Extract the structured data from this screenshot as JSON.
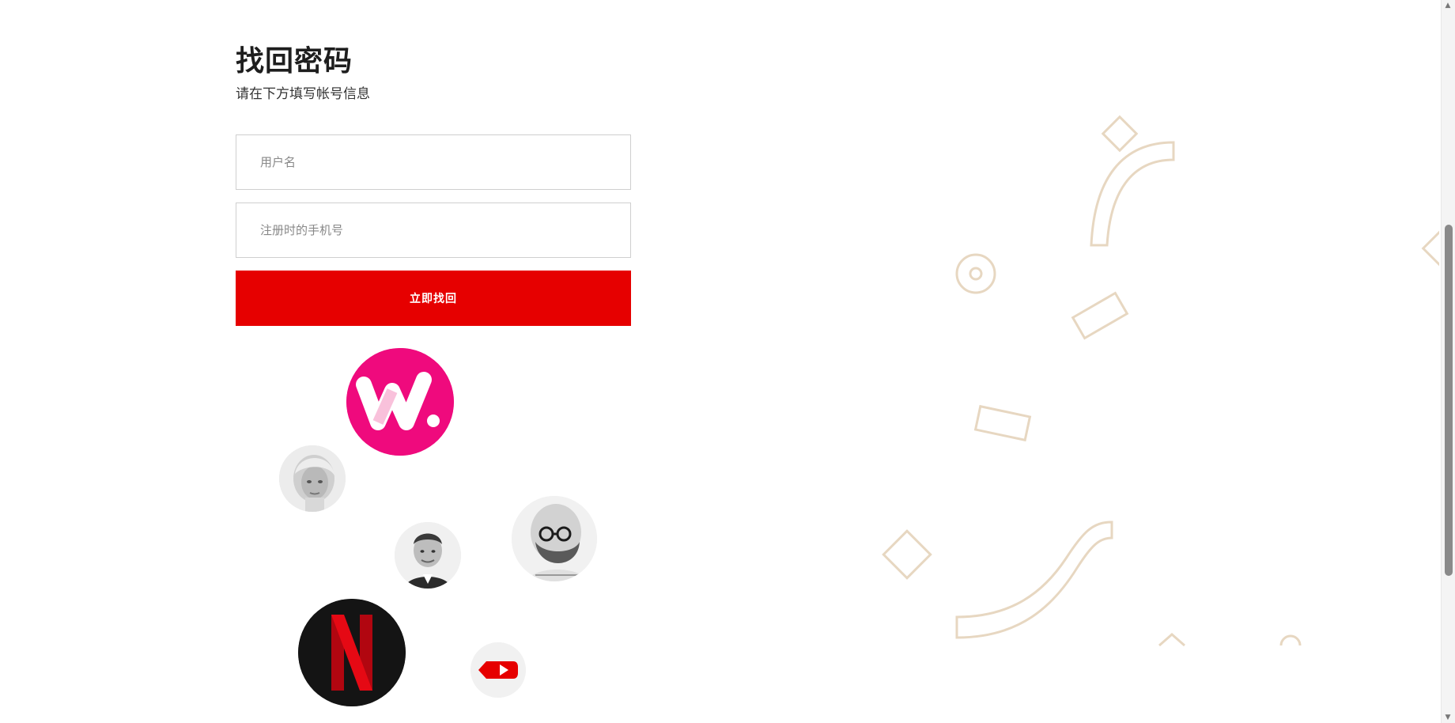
{
  "form": {
    "title": "找回密码",
    "subtitle": "请在下方填写帐号信息",
    "username_placeholder": "用户名",
    "phone_placeholder": "注册时的手机号",
    "submit_label": "立即找回"
  },
  "colors": {
    "accent": "#e60000",
    "decor_stroke": "#e7d7c1",
    "brand_pink": "#ef0a7d"
  },
  "avatars": [
    {
      "name": "brand-w-logo",
      "icon": "w-logo-icon"
    },
    {
      "name": "woman-portrait",
      "icon": "portrait"
    },
    {
      "name": "man-suit-portrait",
      "icon": "portrait"
    },
    {
      "name": "bald-man-portrait",
      "icon": "portrait"
    },
    {
      "name": "netflix-logo",
      "icon": "n-logo-icon"
    },
    {
      "name": "youtube-logo",
      "icon": "play-icon"
    }
  ]
}
